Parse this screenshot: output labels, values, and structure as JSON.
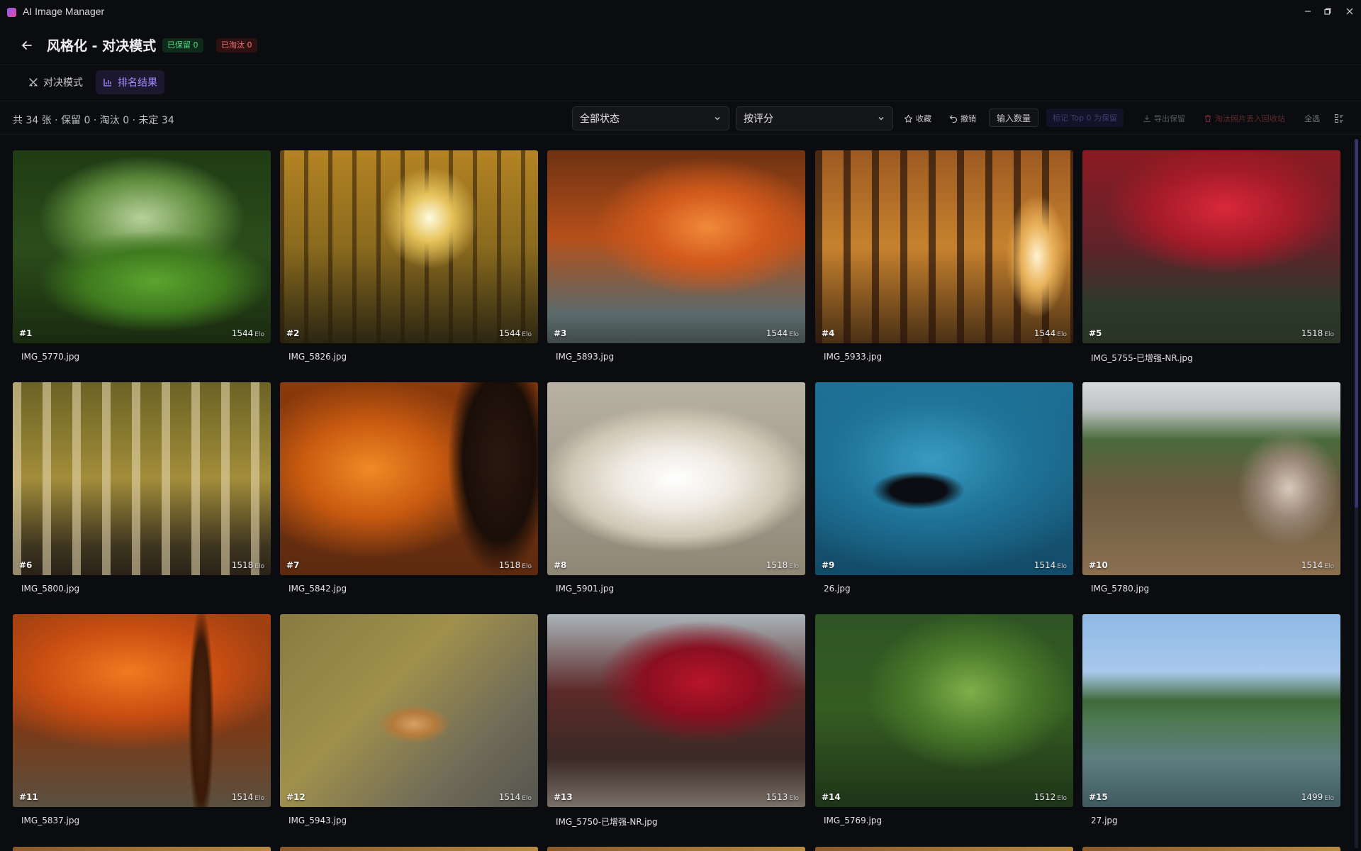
{
  "app": {
    "title": "AI Image Manager"
  },
  "header": {
    "title": "风格化 - 对决模式",
    "badge_kept": "已保留 0",
    "badge_eliminated": "已淘汰 0"
  },
  "tabs": [
    {
      "label": "对决模式"
    },
    {
      "label": "排名结果"
    }
  ],
  "toolbar": {
    "summary": "共 34 张 · 保留 0 · 淘汰 0 · 未定 34",
    "status_filter": "全部状态",
    "sort_by": "按评分",
    "favorite": "收藏",
    "undo": "撤销",
    "input_count": "输入数量",
    "mark_top": "标记 Top 0 为保留",
    "export_kept": "导出保留",
    "move_eliminated": "淘汰照片丢入回收站",
    "select_all": "全选"
  },
  "score_unit": "Elo",
  "photos": [
    {
      "rank": "#1",
      "score": "1544",
      "file": "IMG_5770.jpg"
    },
    {
      "rank": "#2",
      "score": "1544",
      "file": "IMG_5826.jpg"
    },
    {
      "rank": "#3",
      "score": "1544",
      "file": "IMG_5893.jpg"
    },
    {
      "rank": "#4",
      "score": "1544",
      "file": "IMG_5933.jpg"
    },
    {
      "rank": "#5",
      "score": "1518",
      "file": "IMG_5755-已增强-NR.jpg"
    },
    {
      "rank": "#6",
      "score": "1518",
      "file": "IMG_5800.jpg"
    },
    {
      "rank": "#7",
      "score": "1518",
      "file": "IMG_5842.jpg"
    },
    {
      "rank": "#8",
      "score": "1518",
      "file": "IMG_5901.jpg"
    },
    {
      "rank": "#9",
      "score": "1514",
      "file": "26.jpg"
    },
    {
      "rank": "#10",
      "score": "1514",
      "file": "IMG_5780.jpg"
    },
    {
      "rank": "#11",
      "score": "1514",
      "file": "IMG_5837.jpg"
    },
    {
      "rank": "#12",
      "score": "1514",
      "file": "IMG_5943.jpg"
    },
    {
      "rank": "#13",
      "score": "1513",
      "file": "IMG_5750-已增强-NR.jpg"
    },
    {
      "rank": "#14",
      "score": "1512",
      "file": "IMG_5769.jpg"
    },
    {
      "rank": "#15",
      "score": "1499",
      "file": "27.jpg"
    }
  ]
}
